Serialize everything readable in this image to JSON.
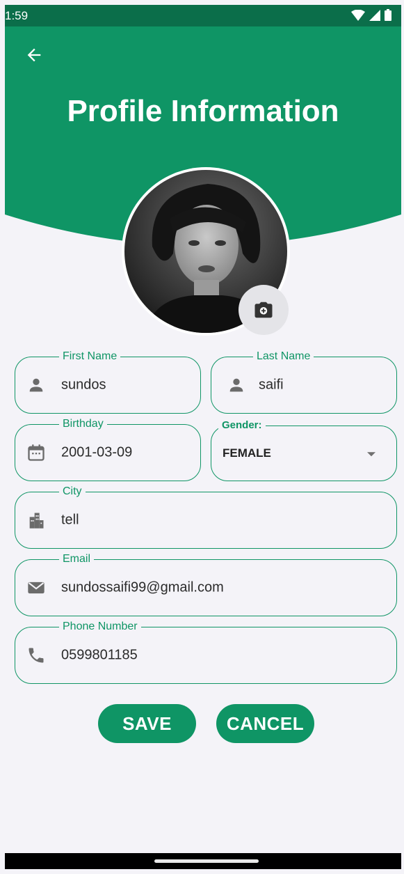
{
  "status_bar": {
    "time": "1:59"
  },
  "header": {
    "title": "Profile Information"
  },
  "colors": {
    "primary": "#0f9565",
    "status_bar": "#0b6e4a",
    "background": "#f4f3f8"
  },
  "icons": {
    "back": "arrow-left-icon",
    "camera": "camera-icon",
    "person": "person-icon",
    "calendar": "calendar-icon",
    "city": "city-icon",
    "email": "email-icon",
    "phone": "phone-icon"
  },
  "form": {
    "first_name": {
      "label": "First Name",
      "value": "sundos"
    },
    "last_name": {
      "label": "Last Name",
      "value": "saifi"
    },
    "birthday": {
      "label": "Birthday",
      "value": "2001-03-09"
    },
    "gender": {
      "label": "Gender:",
      "value": "FEMALE"
    },
    "city": {
      "label": "City",
      "value": "tell"
    },
    "email": {
      "label": "Email",
      "value": "sundossaifi99@gmail.com"
    },
    "phone": {
      "label": "Phone Number",
      "value": "0599801185"
    }
  },
  "actions": {
    "save": "SAVE",
    "cancel": "CANCEL"
  }
}
